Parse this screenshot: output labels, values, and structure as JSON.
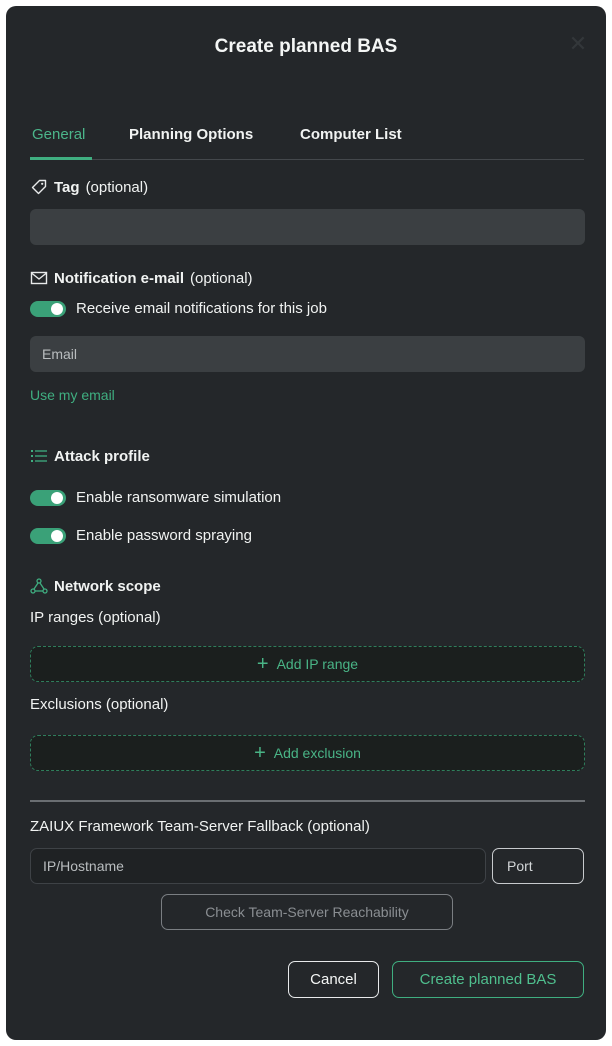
{
  "dialog": {
    "title": "Create planned BAS",
    "close_icon": "close-icon"
  },
  "tabs": [
    {
      "label": "General",
      "active": true
    },
    {
      "label": "Planning Options",
      "active": false
    },
    {
      "label": "Computer List",
      "active": false
    }
  ],
  "tag": {
    "icon": "tag-icon",
    "label_bold": "Tag",
    "label_suffix": "(optional)",
    "value": ""
  },
  "notification": {
    "icon": "mail-icon",
    "label_bold": "Notification e-mail",
    "label_suffix": "(optional)",
    "toggle_label": "Receive email notifications for this job",
    "toggle_on": true,
    "email_placeholder": "Email",
    "use_my_email": "Use my email"
  },
  "attack_profile": {
    "icon": "list-icon",
    "label_bold": "Attack profile",
    "ransomware_label": "Enable ransomware simulation",
    "ransomware_on": true,
    "password_label": "Enable password spraying",
    "password_on": true
  },
  "network_scope": {
    "icon": "network-icon",
    "label_bold": "Network scope",
    "ip_ranges_label": "IP ranges (optional)",
    "add_ip_range": "Add IP range",
    "exclusions_label": "Exclusions (optional)",
    "add_exclusion": "Add exclusion"
  },
  "fallback": {
    "label": "ZAIUX Framework Team-Server Fallback (optional)",
    "host_placeholder": "IP/Hostname",
    "port_placeholder": "Port",
    "check_button": "Check Team-Server Reachability"
  },
  "footer": {
    "cancel": "Cancel",
    "create": "Create planned BAS"
  },
  "colors": {
    "background": "#24272a",
    "accent": "#3fae80",
    "field": "#3b3f42"
  }
}
